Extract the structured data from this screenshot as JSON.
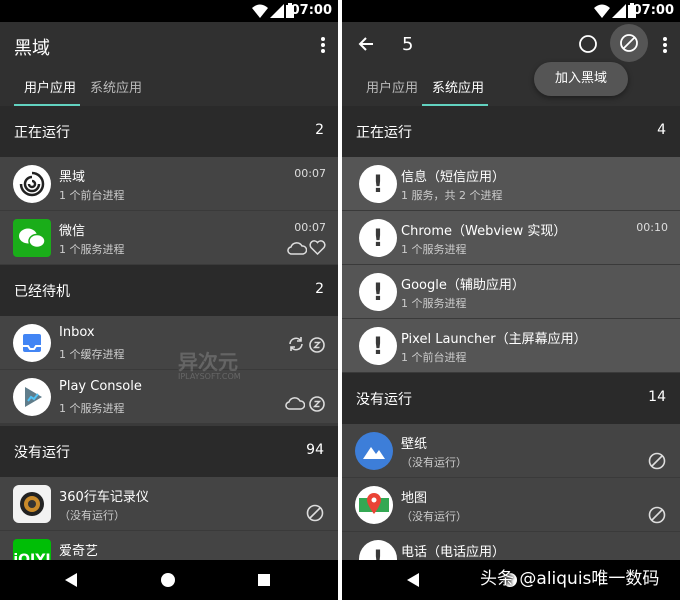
{
  "status": {
    "time": "07:00"
  },
  "left": {
    "title": "黑域",
    "tabs": [
      {
        "label": "用户应用"
      },
      {
        "label": "系统应用"
      }
    ],
    "sections": [
      {
        "title": "正在运行",
        "count": "2"
      },
      {
        "title": "已经待机",
        "count": "2"
      },
      {
        "title": "没有运行",
        "count": "94"
      }
    ],
    "apps": [
      {
        "name": "黑域",
        "sub": "1 个前台进程",
        "time": "00:07"
      },
      {
        "name": "微信",
        "sub": "1 个服务进程",
        "time": "00:07"
      },
      {
        "name": "Inbox",
        "sub": "1 个缓存进程"
      },
      {
        "name": "Play Console",
        "sub": "1 个服务进程"
      },
      {
        "name": "360行车记录仪",
        "sub": "（没有运行）"
      },
      {
        "name": "爱奇艺",
        "sub": ""
      }
    ]
  },
  "right": {
    "title": "5",
    "popup": "加入黑域",
    "tabs": [
      {
        "label": "用户应用"
      },
      {
        "label": "系统应用"
      }
    ],
    "sections": [
      {
        "title": "正在运行",
        "count": "4"
      },
      {
        "title": "没有运行",
        "count": "14"
      }
    ],
    "apps": [
      {
        "name": "信息（短信应用）",
        "sub": "1 服务，共 2 个进程"
      },
      {
        "name": "Chrome（Webview 实现）",
        "sub": "1 个服务进程",
        "time": "00:10"
      },
      {
        "name": "Google（辅助应用）",
        "sub": "1 个服务进程"
      },
      {
        "name": "Pixel Launcher（主屏幕应用）",
        "sub": "1 个前台进程"
      },
      {
        "name": "壁纸",
        "sub": "（没有运行）"
      },
      {
        "name": "地图",
        "sub": "（没有运行）"
      },
      {
        "name": "电话（电话应用）",
        "sub": ""
      }
    ]
  },
  "watermark": {
    "brand": "异次元",
    "domain": "IPLAYSOFT.COM"
  },
  "overlay": {
    "text": "头条 @aliquis唯一数码"
  },
  "icons": [
    "back-arrow-icon",
    "circle-icon",
    "block-icon",
    "more-vert-icon",
    "cloud-icon",
    "heart-icon",
    "sync-icon",
    "alarm-icon",
    "warning-icon",
    "nav-back-icon",
    "nav-home-icon",
    "nav-recents-icon"
  ],
  "colors": {
    "accent": "#62d2c0",
    "appbar": "#303030",
    "row": "#444444",
    "section": "#2a2a2a"
  }
}
